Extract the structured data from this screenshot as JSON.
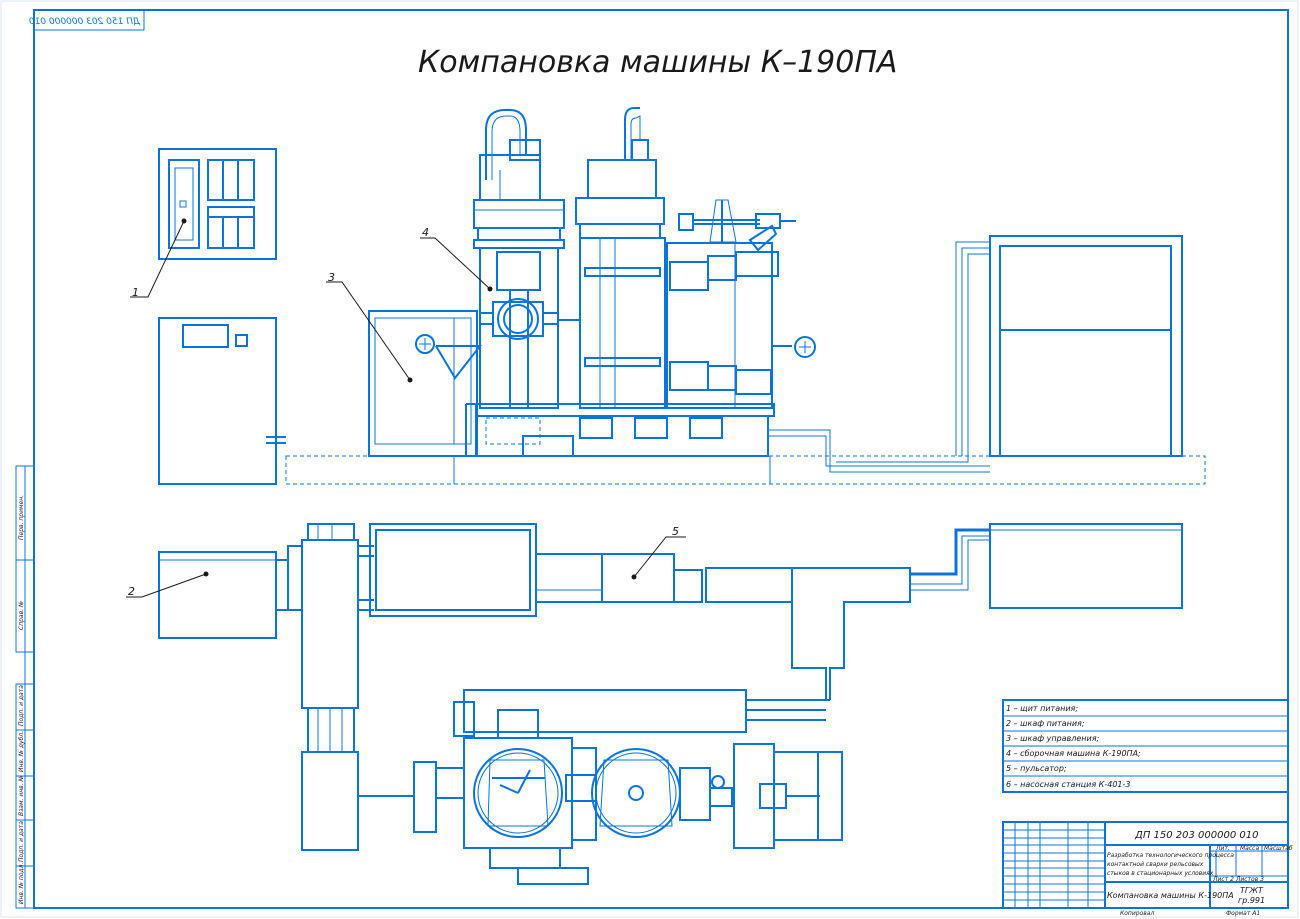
{
  "drawing": {
    "code_mirrored": "ДП 150 203 000000 010",
    "title": "Компановка машины К–190ПА",
    "accent_color": "#0a74da"
  },
  "callouts": [
    "1",
    "2",
    "3",
    "4",
    "5"
  ],
  "legend": [
    "1 – щит питания;",
    "2 – шкаф питания;",
    "3 – шкаф управления;",
    "4 – сборочная машина К-190ПА;",
    "5 – пульсатор;",
    "6 – насосная станция К-401-3"
  ],
  "title_block": {
    "code": "ДП 150 203 000000 010",
    "description_lines": [
      "Разработка технологического процесса",
      "контактной сварки рельсовых",
      "стыков в стационарных условиях"
    ],
    "drawing_name": "Компановка машины К-190ПА",
    "org_line1": "ТГЖТ",
    "org_line2": "гр.991",
    "col_headers": [
      "Лит.",
      "Масса",
      "Масштаб"
    ],
    "sheet_info": "Лист   2   Листов   3",
    "copied": "Копировал",
    "format": "Формат   А1"
  },
  "side_stamp": [
    "Перв. примен.",
    "Справ. №",
    "Подп. и дата",
    "Инв. № дубл.",
    "Взам. инв. №",
    "Подп. и дата",
    "Инв. № подл."
  ]
}
